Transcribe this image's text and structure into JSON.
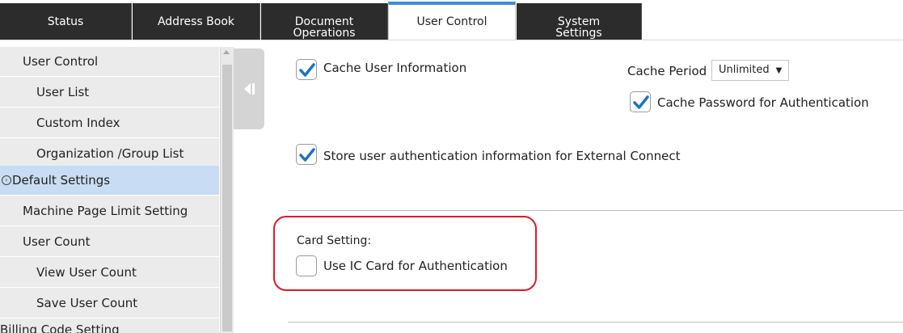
{
  "tabs": [
    {
      "label": "Status",
      "active": false
    },
    {
      "label": "Address Book",
      "active": false
    },
    {
      "label_lines": [
        "Document",
        "Operations"
      ],
      "active": false
    },
    {
      "label": "User Control",
      "active": true
    },
    {
      "label_lines": [
        "System",
        "Settings"
      ],
      "active": false
    }
  ],
  "sidebar": {
    "items": [
      {
        "label": "User Control",
        "level": 1
      },
      {
        "label": "User List",
        "level": 2
      },
      {
        "label": "Custom Index",
        "level": 2
      },
      {
        "label": "Organization /Group List",
        "level": 2
      },
      {
        "label": "Default Settings",
        "level": 0,
        "selected": true,
        "icon": "circle-chevron-right-icon"
      },
      {
        "label": "Machine Page Limit Setting",
        "level": 1
      },
      {
        "label": "User Count",
        "level": 1
      },
      {
        "label": "View User Count",
        "level": 2
      },
      {
        "label": "Save User Count",
        "level": 2
      },
      {
        "label": "Billing Code Setting",
        "level": 0
      }
    ]
  },
  "main": {
    "cache_user_info": {
      "label": "Cache User Information",
      "checked": true
    },
    "cache_period": {
      "label": "Cache Period",
      "value": "Unlimited"
    },
    "cache_password": {
      "label": "Cache Password for Authentication",
      "checked": true
    },
    "store_auth": {
      "label": "Store user authentication information for External Connect",
      "checked": true
    },
    "card_setting": {
      "heading": "Card Setting:",
      "use_ic_card": {
        "label": "Use IC Card for Authentication",
        "checked": false
      }
    }
  },
  "colors": {
    "tab_dark": "#2c2c2c",
    "tab_active_accent": "#3a8dde",
    "selected_row": "#c8dcf3",
    "checkbox_check": "#1a73c8",
    "highlight_box": "#e0192a"
  }
}
